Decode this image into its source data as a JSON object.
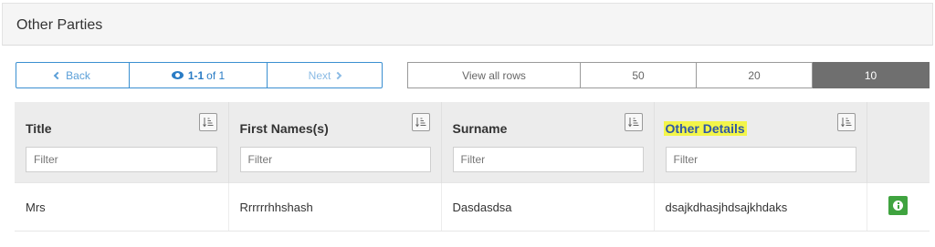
{
  "panel": {
    "title": "Other Parties"
  },
  "pager": {
    "back_label": "Back",
    "range": "1-1",
    "of_label": "of 1",
    "next_label": "Next"
  },
  "rows_selector": {
    "options": [
      "View all rows",
      "50",
      "20",
      "10"
    ],
    "selected": "10"
  },
  "table": {
    "columns": [
      {
        "title": "Title",
        "filter_placeholder": "Filter"
      },
      {
        "title": "First Names(s)",
        "filter_placeholder": "Filter"
      },
      {
        "title": "Surname",
        "filter_placeholder": "Filter"
      },
      {
        "title": "Other Details",
        "filter_placeholder": "Filter",
        "highlighted": true
      }
    ],
    "rows": [
      {
        "title": "Mrs",
        "first_names": "Rrrrrrhhshash",
        "surname": "Dasdasdsa",
        "other_details": "dsajkdhasjhdsajkhdaks",
        "action_icon": "info-icon"
      }
    ]
  },
  "colors": {
    "accent": "#3a8fd1",
    "selected_rows": "#6f6f6f",
    "highlight": "#f3f54a",
    "info_button": "#3fa33f"
  }
}
